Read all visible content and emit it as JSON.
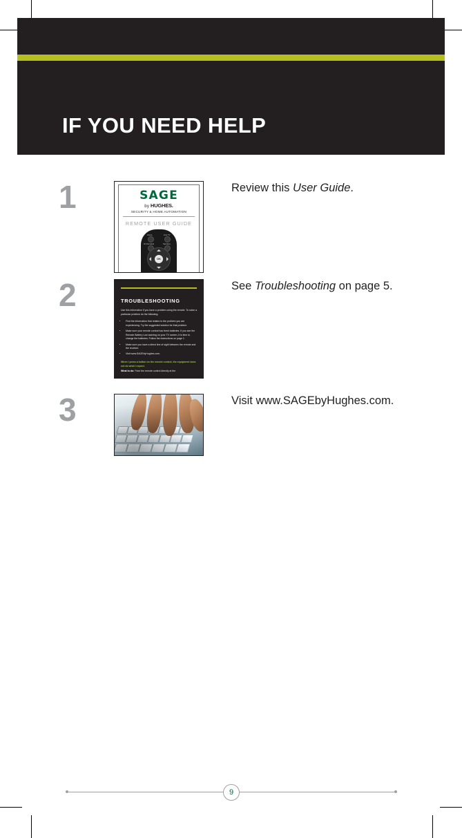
{
  "document": {
    "page_title": "IF YOU NEED HELP",
    "page_number": "9"
  },
  "colors": {
    "header_dark": "#231f20",
    "accent_green": "#b5c01f",
    "brand_green": "#00693c",
    "step_number_gray": "#9ea0a3"
  },
  "steps": [
    {
      "number": "1",
      "text_before": "Review this ",
      "text_italic": "User Guide",
      "text_after": "."
    },
    {
      "number": "2",
      "text_before": "See ",
      "text_italic": "Troubleshooting",
      "text_after": " on page 5."
    },
    {
      "number": "3",
      "text_before": "Visit www.SAGEbyHughes.com.",
      "text_italic": "",
      "text_after": ""
    }
  ],
  "thumbnail_user_guide": {
    "brand": "SAGE",
    "by_line_prefix": "by ",
    "by_line_brand": "HUGHES.",
    "tagline": "SECURITY & HOME AUTOMATION",
    "subtitle": "REMOTE USER GUIDE",
    "remote_buttons": [
      {
        "label": "Home"
      },
      {
        "label": "Live TV"
      },
      {
        "label": "On Demand"
      },
      {
        "label": "Services"
      }
    ],
    "dpad_center_label": "OK"
  },
  "thumbnail_troubleshooting": {
    "heading": "TROUBLESHOOTING",
    "intro": "Use this information if you have a problem using the remote. To solve a particular problem do the following:",
    "bullets": [
      "Find the information that relates to the problem you are experiencing. Try the suggested solution for that problem.",
      "Make sure your remote control has fresh batteries. If you see the Remote Battery Low warning on your TV screen, it is time to change the batteries. Follow the instructions on page 1.",
      "Make sure you have a direct line of sight between the remote and the receiver.",
      "Visit www.SAGEbyHughes.com."
    ],
    "question": "When I press a button on the remote control, the equipment does not do what I expect.",
    "answer_label": "What to do:",
    "answer_text": " Point the remote control directly at the"
  }
}
